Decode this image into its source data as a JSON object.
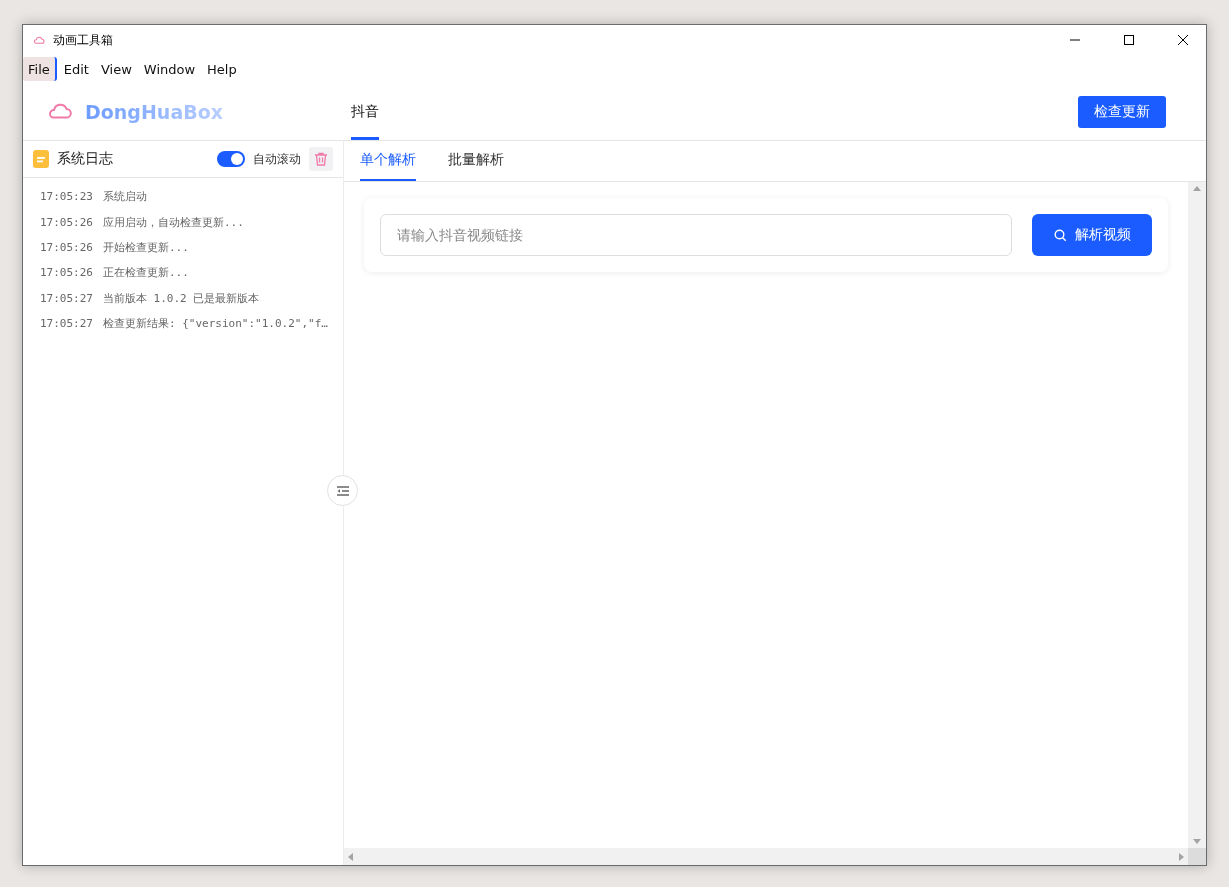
{
  "window": {
    "title": "动画工具箱"
  },
  "menu": [
    {
      "label": "File",
      "selected": true
    },
    {
      "label": "Edit",
      "selected": false
    },
    {
      "label": "View",
      "selected": false
    },
    {
      "label": "Window",
      "selected": false
    },
    {
      "label": "Help",
      "selected": false
    }
  ],
  "header": {
    "logo": "DongHuaBox",
    "nav": [
      {
        "label": "抖音",
        "selected": true
      }
    ],
    "update_button": "检查更新"
  },
  "sidebar": {
    "title": "系统日志",
    "auto_scroll": {
      "label": "自动滚动",
      "on": true
    },
    "logs": [
      {
        "time": "17:05:23",
        "message": "系统启动"
      },
      {
        "time": "17:05:26",
        "message": "应用启动，自动检查更新..."
      },
      {
        "time": "17:05:26",
        "message": "开始检查更新..."
      },
      {
        "time": "17:05:26",
        "message": "正在检查更新..."
      },
      {
        "time": "17:05:27",
        "message": "当前版本 1.0.2 已是最新版本"
      },
      {
        "time": "17:05:27",
        "message": "检查更新结果: {\"version\":\"1.0.2\",\"f…"
      }
    ]
  },
  "tabs": [
    {
      "label": "单个解析",
      "selected": true
    },
    {
      "label": "批量解析",
      "selected": false
    }
  ],
  "parse": {
    "placeholder": "请输入抖音视频链接",
    "button": "解析视频"
  }
}
